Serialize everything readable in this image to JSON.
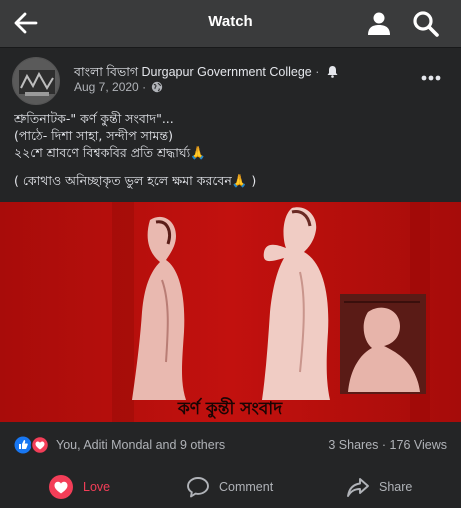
{
  "header": {
    "title": "Watch",
    "icons": [
      "back-arrow-icon",
      "profile-icon",
      "search-icon"
    ]
  },
  "post": {
    "page_name": "বাংলা বিভাগ Durgapur Government College",
    "separator": "·",
    "date": "Aug 7, 2020",
    "audience_icon": "globe-icon",
    "text_lines": [
      "শ্রুতিনাটক-\" কর্ণ কুন্তী সংবাদ\"...",
      "(পাঠে- দিশা সাহা, সন্দীপ সামন্ত)",
      "২২শে শ্রাবণে বিশ্বকবির প্রতি শ্রদ্ধার্ঘ্য🙏",
      "( কোথাও অনিচ্ছাকৃত ভুল হলে ক্ষমা করবেন🙏 )"
    ],
    "video": {
      "caption": "কর্ণ   কুন্তী   সংবাদ",
      "background": "#b40e0c"
    }
  },
  "engagement": {
    "reaction_icons": [
      "like-icon",
      "love-icon"
    ],
    "reactions_text": "You, Aditi Mondal and 9 others",
    "shares": "3 Shares",
    "separator": "·",
    "views": "176 Views"
  },
  "actions": {
    "love": "Love",
    "comment": "Comment",
    "share": "Share"
  },
  "colors": {
    "topbar": "#3a3b3c",
    "card": "#242526",
    "text": "#e4e6eb",
    "secondary": "#b0b3b8",
    "love": "#f33e58",
    "like": "#1877f2"
  }
}
